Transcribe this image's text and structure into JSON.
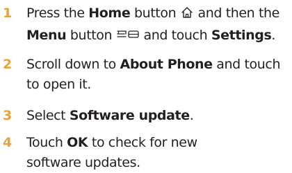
{
  "steps": [
    {
      "number": "1",
      "line1": {
        "a": "Press the ",
        "b": "Home",
        "c": " button ",
        "d": " and then the"
      },
      "line2": {
        "a": "Menu",
        "b": " button ",
        "c": " and touch ",
        "d": "Settings",
        "e": "."
      }
    },
    {
      "number": "2",
      "line1": {
        "a": "Scroll down to ",
        "b": "About Phone",
        "c": " and touch"
      },
      "line2": {
        "a": "to open it."
      }
    },
    {
      "number": "3",
      "line1": {
        "a": "Select ",
        "b": "Software update",
        "c": "."
      }
    },
    {
      "number": "4",
      "line1": {
        "a": "Touch ",
        "b": "OK",
        "c": " to check for new"
      },
      "line2": {
        "a": "software updates."
      }
    }
  ],
  "icons": {
    "home": "home-icon",
    "menu": "menu-icon"
  },
  "colors": {
    "step_number": "#e8a23a",
    "text": "#231f20"
  }
}
